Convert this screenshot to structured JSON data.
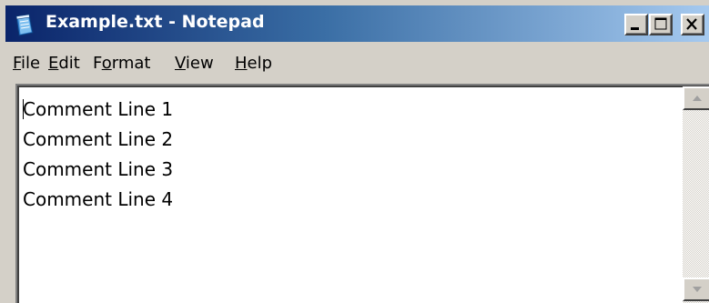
{
  "window": {
    "title": "Example.txt - Notepad",
    "app_icon": "notepad-icon"
  },
  "caption_buttons": {
    "minimize_icon": "minimize-icon",
    "maximize_icon": "maximize-icon",
    "close_icon": "close-icon"
  },
  "menu": {
    "items": [
      {
        "label": "File",
        "mnemonic": "F"
      },
      {
        "label": "Edit",
        "mnemonic": "E"
      },
      {
        "label": "Format",
        "mnemonic": "o"
      },
      {
        "label": "View",
        "mnemonic": "V"
      },
      {
        "label": "Help",
        "mnemonic": "H"
      }
    ]
  },
  "document": {
    "lines": [
      "Comment Line 1",
      "Comment Line 2",
      "Comment Line 3",
      "Comment Line 4"
    ]
  },
  "scrollbar": {
    "up_icon": "scroll-up-arrow-icon",
    "down_icon": "scroll-down-arrow-icon"
  },
  "colors": {
    "titlebar_start": "#0a246a",
    "titlebar_end": "#a6caf0",
    "chrome": "#d4d0c8",
    "text_background": "#ffffff"
  }
}
